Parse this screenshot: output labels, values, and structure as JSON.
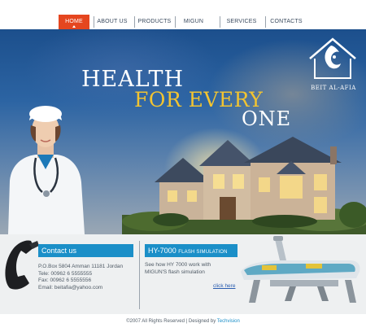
{
  "nav": {
    "items": [
      {
        "label": "HOME",
        "active": true
      },
      {
        "label": "ABOUT US",
        "active": false
      },
      {
        "label": "PRODUCTS",
        "active": false
      },
      {
        "label": "MIGUN",
        "active": false
      },
      {
        "label": "SERVICES",
        "active": false
      },
      {
        "label": "CONTACTS",
        "active": false
      }
    ],
    "active_color": "#e5461f"
  },
  "hero": {
    "line1": "HEALTH",
    "line2": "FOR EVERY",
    "line3": "ONE",
    "line2_color": "#f2c431"
  },
  "logo": {
    "text": "BEIT AL-AFIA"
  },
  "contact": {
    "heading": "Contact us",
    "lines": [
      "P.O.Box 5804 Amman 11181 Jordan",
      "Tele: 00962 6 5555555",
      "Fax: 00962 6 5555556",
      "Email: beitafia@yahoo.com"
    ]
  },
  "product": {
    "heading_big": "HY-7000",
    "heading_small": "FLASH SIMULATION",
    "text_lines": [
      "See how HY 7000 work with",
      "MIGUN'S flash simulation"
    ],
    "link": "click here"
  },
  "footer": {
    "copyright": "©2007 All Rights Reserved | Designed by",
    "designer": "Techvision"
  },
  "colors": {
    "accent": "#1b8fc8"
  }
}
